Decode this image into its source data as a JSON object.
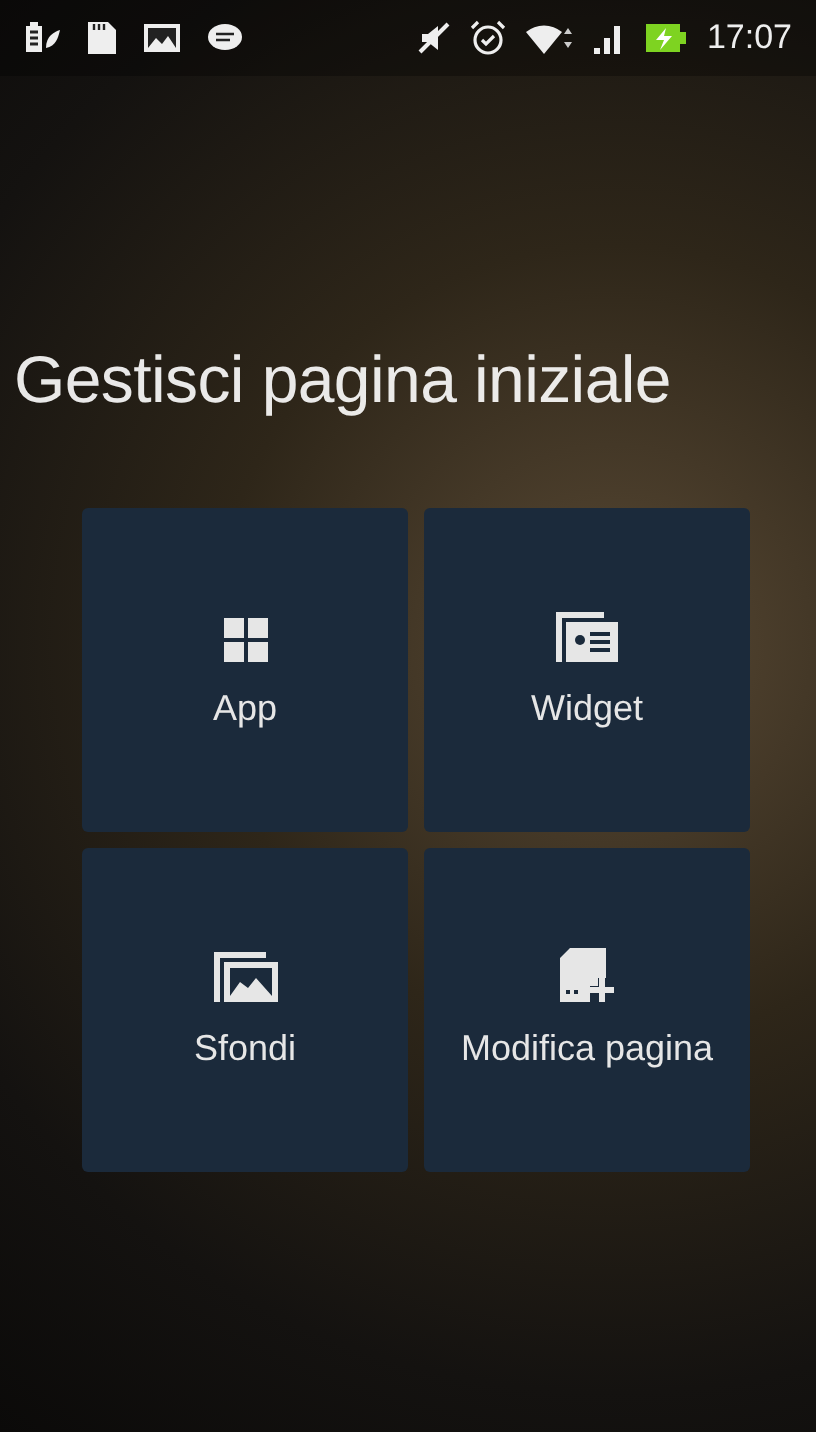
{
  "status_bar": {
    "time": "17:07"
  },
  "title": "Gestisci pagina iniziale",
  "tiles": [
    {
      "kind": "apps",
      "label": "App"
    },
    {
      "kind": "widgets",
      "label": "Widget"
    },
    {
      "kind": "wallpapers",
      "label": "Sfondi"
    },
    {
      "kind": "edit_page",
      "label": "Modifica pagina"
    }
  ]
}
